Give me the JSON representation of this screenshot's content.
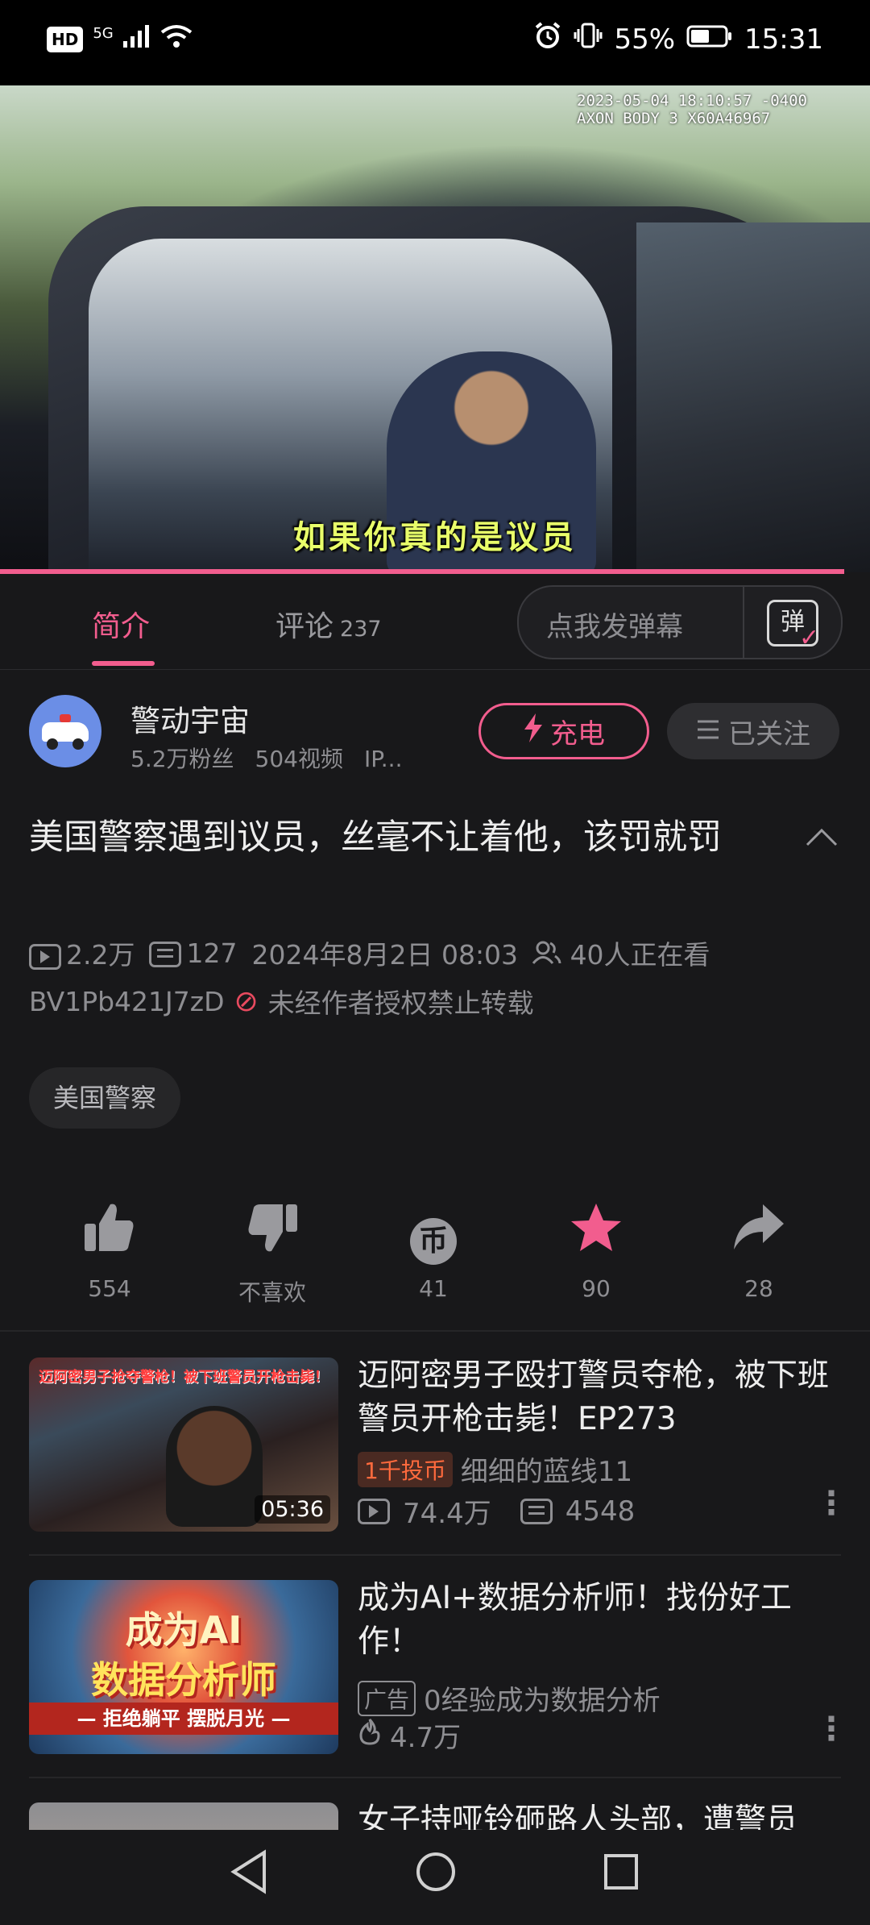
{
  "status_bar": {
    "left_text": "5G",
    "hd": "HD",
    "battery": "55%",
    "time": "15:31"
  },
  "video": {
    "timestamp_line1": "2023-05-04 18:10:57 -0400",
    "timestamp_line2": "AXON BODY 3 X60A46967",
    "subtitle": "如果你真的是议员",
    "progress_fraction": 0.97
  },
  "tabs": {
    "intro": "简介",
    "comments": "评论",
    "comments_count": "237",
    "danmaku_placeholder": "点我发弹幕",
    "danmaku_icon_char": "弹"
  },
  "uploader": {
    "name": "警动宇宙",
    "fans": "5.2万粉丝",
    "videos": "504视频",
    "ip": "IP...",
    "charge_label": "充电",
    "follow_label": "已关注"
  },
  "video_info": {
    "title": "美国警察遇到议员，丝毫不让着他，该罚就罚",
    "views": "2.2万",
    "danmaku_count": "127",
    "date": "2024年8月2日 08:03",
    "watching": "40人正在看",
    "bvid": "BV1Pb421J7zD",
    "copyright": "未经作者授权禁止转载",
    "tag": "美国警察"
  },
  "actions": {
    "like": "554",
    "dislike": "不喜欢",
    "coin": "41",
    "favorite": "90",
    "share": "28",
    "coin_glyph": "币"
  },
  "related": [
    {
      "title": "迈阿密男子殴打警员夺枪，被下班警员开枪击毙！EP273",
      "thumb_text": "迈阿密男子抢夺警枪！被下班警员开枪击毙！",
      "duration": "05:36",
      "badge": "1千投币",
      "author": "细细的蓝线11",
      "views": "74.4万",
      "danmaku": "4548"
    },
    {
      "title": "成为AI+数据分析师！找份好工作！",
      "thumb_line1": "成为AI",
      "thumb_line2": "数据分析师",
      "thumb_strip": "— 拒绝躺平 摆脱月光 —",
      "badge": "广告",
      "author": "0经验成为数据分析",
      "heat": "4.7万"
    },
    {
      "title": "女子持哑铃砸路人头部，遭警员"
    }
  ],
  "icons": {
    "accent": "#f25d8e"
  }
}
